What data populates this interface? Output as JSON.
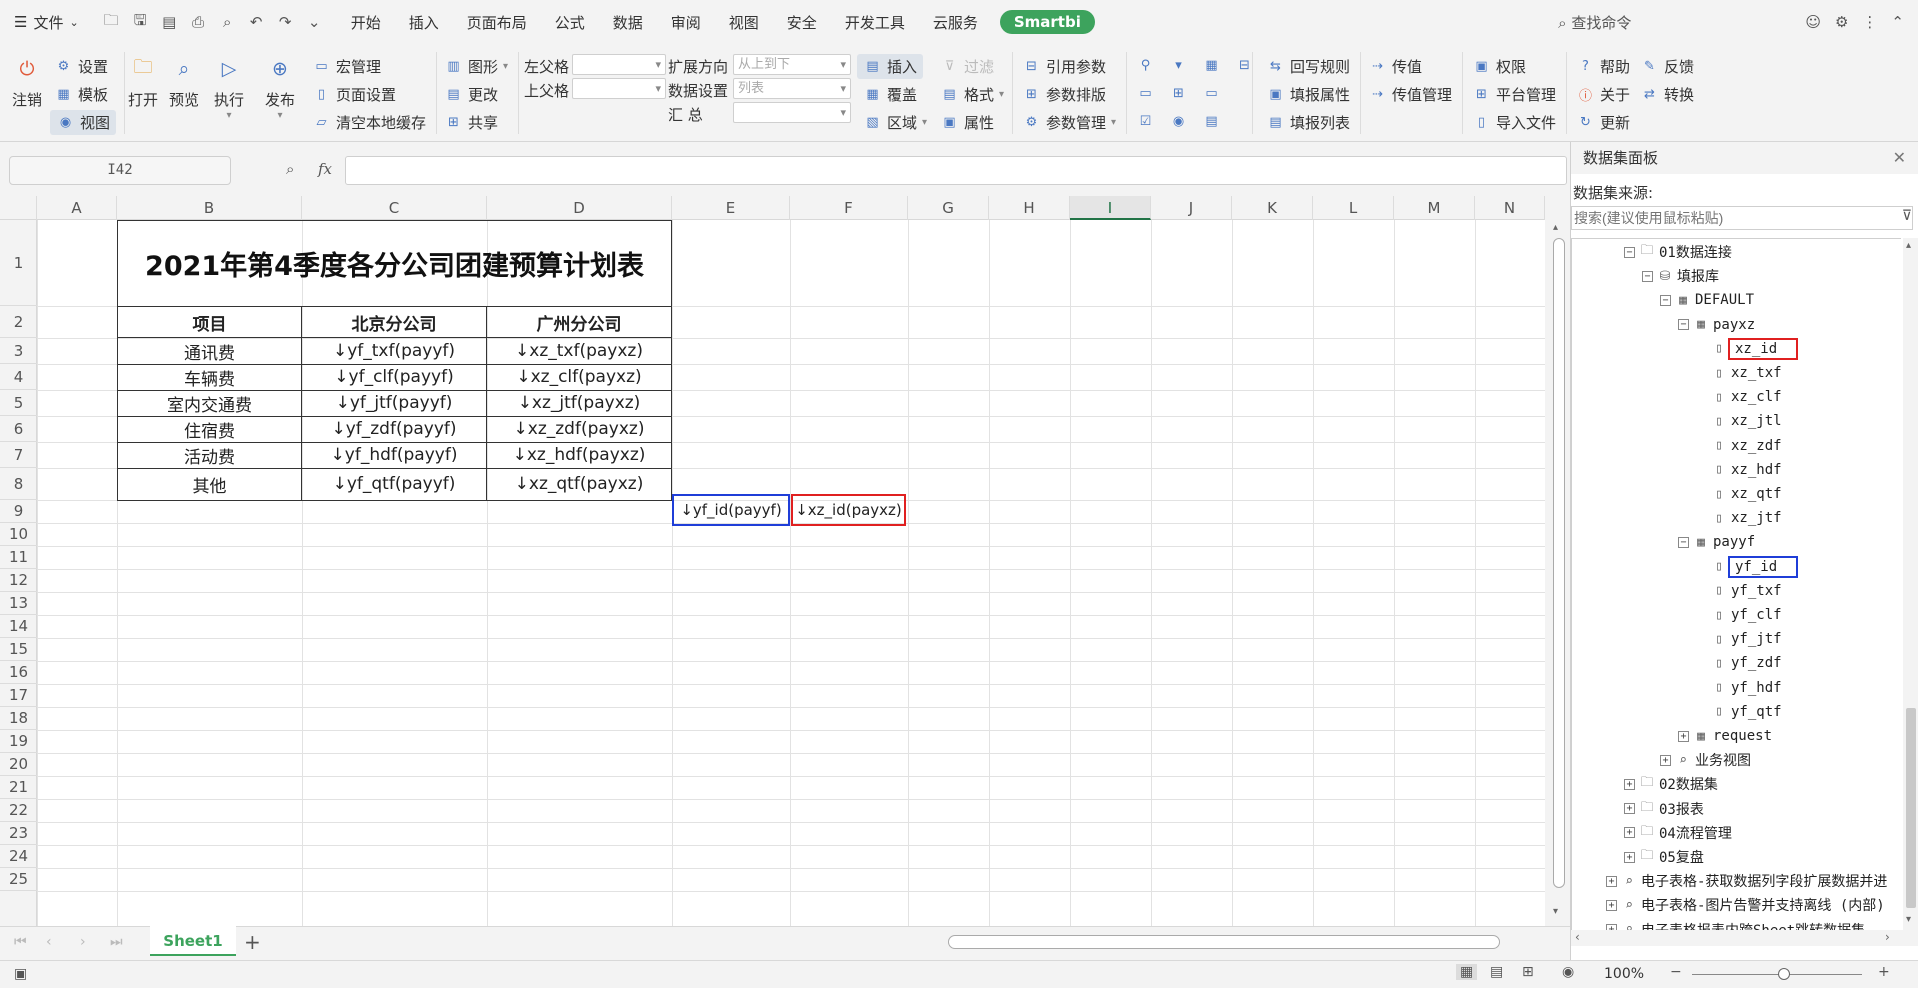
{
  "menubar": {
    "file_label": "文件",
    "tabs": [
      "开始",
      "插入",
      "页面布局",
      "公式",
      "数据",
      "审阅",
      "视图",
      "安全",
      "开发工具",
      "云服务"
    ],
    "smartbi_label": "Smartbi",
    "search_label": "查找命令"
  },
  "ribbon": {
    "logout": "注销",
    "settings": "设置",
    "template": "模板",
    "view": "视图",
    "open": "打开",
    "preview": "预览",
    "execute": "执行",
    "publish": "发布",
    "macro": "宏管理",
    "page_setup": "页面设置",
    "clear_cache": "清空本地缓存",
    "shape": "图形",
    "change": "更改",
    "share": "共享",
    "left_parent": "左父格",
    "top_parent": "上父格",
    "expand_dir": "扩展方向",
    "expand_dir_value": "从上到下",
    "data_setting": "数据设置",
    "data_setting_value": "列表",
    "summary": "汇    总",
    "insert": "插入",
    "cover": "覆盖",
    "region": "区域",
    "filter": "过滤",
    "format": "格式",
    "attribute": "属性",
    "ref_param": "引用参数",
    "param_layout": "参数排版",
    "param_mgmt": "参数管理",
    "writeback": "回写规则",
    "fill_attr": "填报属性",
    "fill_list": "填报列表",
    "pass_value": "传值",
    "pass_value_mgmt": "传值管理",
    "permission": "权限",
    "platform_mgmt": "平台管理",
    "import_file": "导入文件",
    "help": "帮助",
    "feedback": "反馈",
    "about": "关于",
    "convert": "转换",
    "update": "更新"
  },
  "formula_bar": {
    "name_box": "I42",
    "fx": "fx",
    "formula": ""
  },
  "columns": [
    "A",
    "B",
    "C",
    "D",
    "E",
    "F",
    "G",
    "H",
    "I",
    "J",
    "K",
    "L",
    "M",
    "N"
  ],
  "rows": [
    "1",
    "2",
    "3",
    "4",
    "5",
    "6",
    "7",
    "8",
    "9",
    "10",
    "11",
    "12",
    "13",
    "14",
    "15",
    "16",
    "17",
    "18",
    "19",
    "20",
    "21",
    "22",
    "23",
    "24",
    "25"
  ],
  "sheet": {
    "title": "2021年第4季度各分公司团建预算计划表",
    "headers": [
      "项目",
      "北京分公司",
      "广州分公司"
    ],
    "items": [
      {
        "name": "通讯费",
        "bj": "↓yf_txf(payyf)",
        "gz": "↓xz_txf(payxz)"
      },
      {
        "name": "车辆费",
        "bj": "↓yf_clf(payyf)",
        "gz": "↓xz_clf(payxz)"
      },
      {
        "name": "室内交通费",
        "bj": "↓yf_jtf(payyf)",
        "gz": "↓xz_jtf(payxz)"
      },
      {
        "name": "住宿费",
        "bj": "↓yf_zdf(payyf)",
        "gz": "↓xz_zdf(payxz)"
      },
      {
        "name": "活动费",
        "bj": "↓yf_hdf(payyf)",
        "gz": "↓xz_hdf(payxz)"
      },
      {
        "name": "其他",
        "bj": "↓yf_qtf(payyf)",
        "gz": "↓xz_qtf(payxz)"
      }
    ],
    "e8": "↓yf_id(payyf)",
    "f8": "↓xz_id(payxz)"
  },
  "sheet_tab": "Sheet1",
  "add_sheet": "+",
  "zoom": "100%",
  "panel": {
    "title": "数据集面板",
    "source_label": "数据集来源:",
    "search_placeholder": "搜索(建议使用鼠标粘贴)",
    "tree": {
      "n01": "01数据连接",
      "fill_db": "填报库",
      "default": "DEFAULT",
      "payxz": "payxz",
      "payxz_fields": [
        "xz_id",
        "xz_txf",
        "xz_clf",
        "xz_jtl",
        "xz_zdf",
        "xz_hdf",
        "xz_qtf",
        "xz_jtf"
      ],
      "payyf": "payyf",
      "payyf_fields": [
        "yf_id",
        "yf_txf",
        "yf_clf",
        "yf_jtf",
        "yf_zdf",
        "yf_hdf",
        "yf_qtf"
      ],
      "request": "request",
      "biz_view": "业务视图",
      "n02": "02数据集",
      "n03": "03报表",
      "n04": "04流程管理",
      "n05": "05复盘",
      "e1": "电子表格-获取数据列字段扩展数据并进",
      "e2": "电子表格-图片告警并支持离线 (内部)",
      "e3": "电子表格报表内跨Sheet跳转数据集"
    }
  },
  "colors": {
    "accent": "#3da35d",
    "red_highlight": "#e02020",
    "blue_highlight": "#1f3ed8"
  }
}
